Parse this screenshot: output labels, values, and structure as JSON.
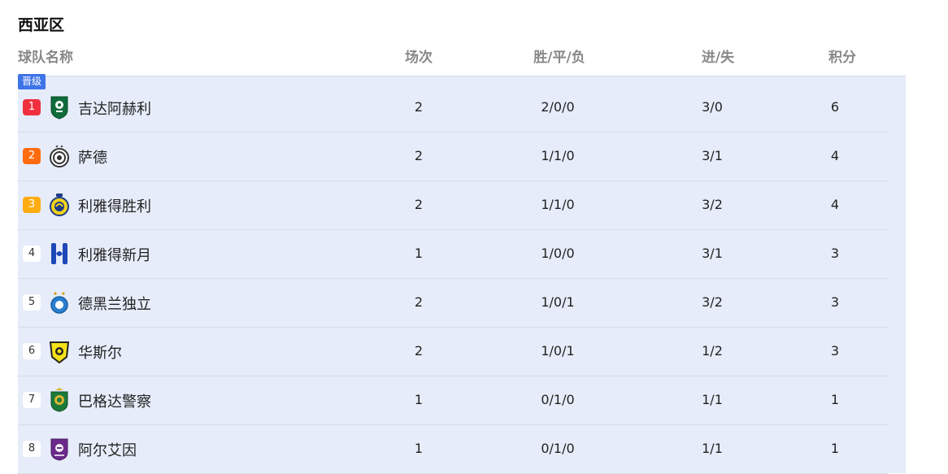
{
  "section": {
    "title": "西亚区"
  },
  "headers": {
    "team": "球队名称",
    "played": "场次",
    "wdl": "胜/平/负",
    "goals": "进/失",
    "points": "积分"
  },
  "promotion_badge": "晋级",
  "colors": {
    "rank1": "#f0303f",
    "rank2": "#ff6b10",
    "rank3": "#ffac12",
    "promotion": "#3f74e8",
    "table_bg": "#e6ecf9"
  },
  "rows": [
    {
      "rank": "1",
      "team": "吉达阿赫利",
      "played": "2",
      "wdl": "2/0/0",
      "goals": "3/0",
      "points": "6",
      "logo": "al-ahli-crest-icon"
    },
    {
      "rank": "2",
      "team": "萨德",
      "played": "2",
      "wdl": "1/1/0",
      "goals": "3/1",
      "points": "4",
      "logo": "al-sadd-crest-icon"
    },
    {
      "rank": "3",
      "team": "利雅得胜利",
      "played": "2",
      "wdl": "1/1/0",
      "goals": "3/2",
      "points": "4",
      "logo": "al-nassr-crest-icon"
    },
    {
      "rank": "4",
      "team": "利雅得新月",
      "played": "1",
      "wdl": "1/0/0",
      "goals": "3/1",
      "points": "3",
      "logo": "al-hilal-crest-icon"
    },
    {
      "rank": "5",
      "team": "德黑兰独立",
      "played": "2",
      "wdl": "1/0/1",
      "goals": "3/2",
      "points": "3",
      "logo": "esteghlal-crest-icon"
    },
    {
      "rank": "6",
      "team": "华斯尔",
      "played": "2",
      "wdl": "1/0/1",
      "goals": "1/2",
      "points": "3",
      "logo": "al-wasl-crest-icon"
    },
    {
      "rank": "7",
      "team": "巴格达警察",
      "played": "1",
      "wdl": "0/1/0",
      "goals": "1/1",
      "points": "1",
      "logo": "al-shorta-crest-icon"
    },
    {
      "rank": "8",
      "team": "阿尔艾因",
      "played": "1",
      "wdl": "0/1/0",
      "goals": "1/1",
      "points": "1",
      "logo": "al-ain-crest-icon"
    }
  ]
}
